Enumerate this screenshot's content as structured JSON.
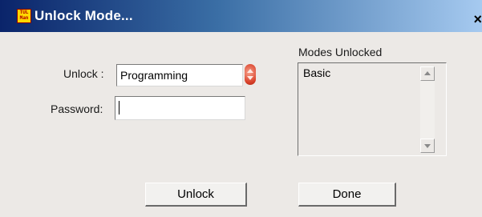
{
  "window": {
    "title": "Unlock Mode...",
    "icon_lines": [
      "TUL",
      "Man"
    ],
    "close_glyph": "×"
  },
  "form": {
    "unlock_label": "Unlock :",
    "unlock_value": "Programming",
    "password_label": "Password:",
    "password_value": ""
  },
  "modes": {
    "header": "Modes Unlocked",
    "items": [
      "Basic"
    ]
  },
  "buttons": {
    "unlock_label": "Unlock",
    "done_label": "Done"
  },
  "colors": {
    "title_gradient_start": "#0a246a",
    "title_gradient_end": "#a6caf0",
    "window_bg": "#ece9e6",
    "spinner_accent": "#d9412a"
  }
}
